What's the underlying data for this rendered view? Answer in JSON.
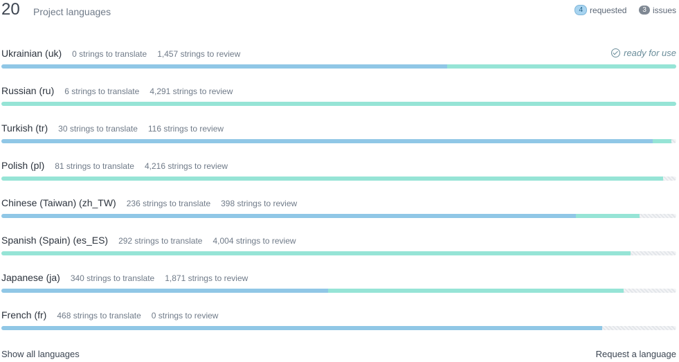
{
  "header": {
    "count": "20",
    "title": "Project languages",
    "legend": {
      "requested_badge": "4",
      "requested_label": "requested",
      "issues_badge": "3",
      "issues_label": "issues"
    }
  },
  "colors": {
    "translated": "#90c7e6",
    "reviewed": "#96e4d6",
    "untranslated": "#e3e6ea"
  },
  "languages": [
    {
      "name": "Ukrainian (uk)",
      "to_translate": "0 strings to translate",
      "to_review": "1,457 strings to review",
      "status": "ready for use",
      "translated_pct": 66,
      "reviewed_pct": 34
    },
    {
      "name": "Russian (ru)",
      "to_translate": "6 strings to translate",
      "to_review": "4,291 strings to review",
      "translated_pct": 0,
      "reviewed_pct": 100
    },
    {
      "name": "Turkish (tr)",
      "to_translate": "30 strings to translate",
      "to_review": "116 strings to review",
      "translated_pct": 96.5,
      "reviewed_pct": 2.8
    },
    {
      "name": "Polish (pl)",
      "to_translate": "81 strings to translate",
      "to_review": "4,216 strings to review",
      "translated_pct": 0,
      "reviewed_pct": 98.1
    },
    {
      "name": "Chinese (Taiwan) (zh_TW)",
      "to_translate": "236 strings to translate",
      "to_review": "398 strings to review",
      "translated_pct": 85.1,
      "reviewed_pct": 9.5
    },
    {
      "name": "Spanish (Spain) (es_ES)",
      "to_translate": "292 strings to translate",
      "to_review": "4,004 strings to review",
      "translated_pct": 0,
      "reviewed_pct": 93.2
    },
    {
      "name": "Japanese (ja)",
      "to_translate": "340 strings to translate",
      "to_review": "1,871 strings to review",
      "translated_pct": 48.4,
      "reviewed_pct": 43.8
    },
    {
      "name": "French (fr)",
      "to_translate": "468 strings to translate",
      "to_review": "0 strings to review",
      "translated_pct": 89,
      "reviewed_pct": 0
    }
  ],
  "footer": {
    "show_all": "Show all languages",
    "request": "Request a language"
  }
}
